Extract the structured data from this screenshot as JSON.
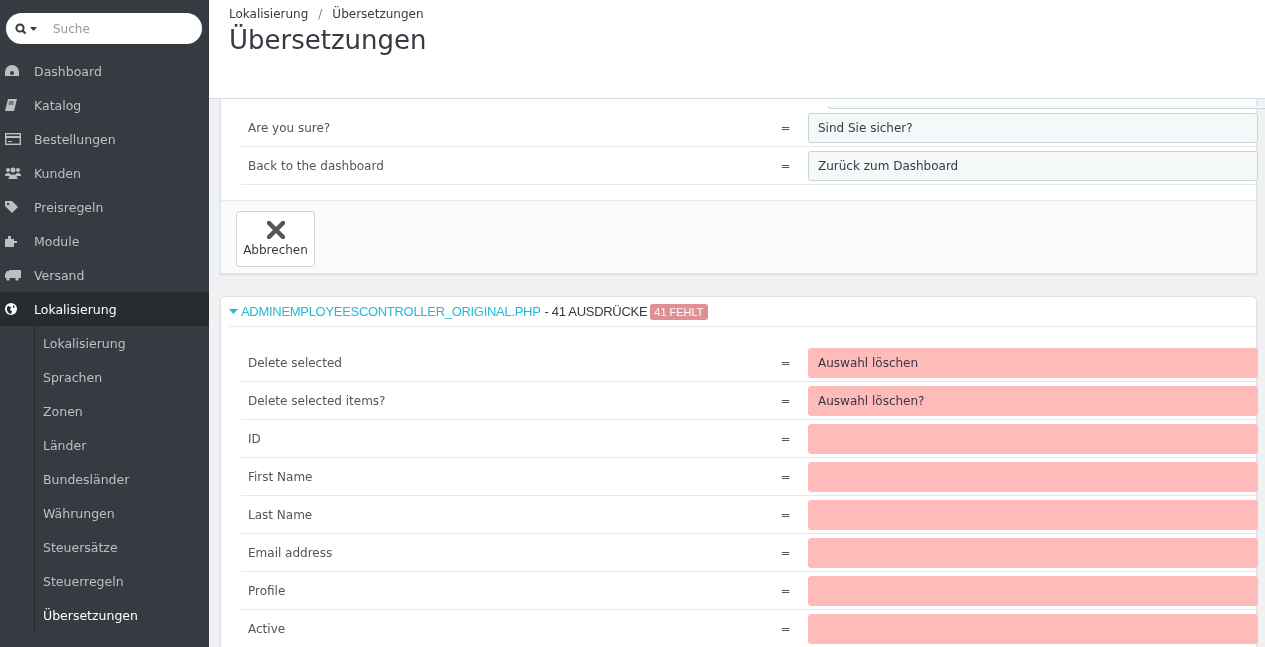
{
  "search": {
    "placeholder": "Suche"
  },
  "sidebar": {
    "items": [
      {
        "label": "Dashboard",
        "kind": "dashboard",
        "selected": false
      },
      {
        "label": "Katalog",
        "kind": "book",
        "selected": false
      },
      {
        "label": "Bestellungen",
        "kind": "card",
        "selected": false
      },
      {
        "label": "Kunden",
        "kind": "users",
        "selected": false
      },
      {
        "label": "Preisregeln",
        "kind": "tags",
        "selected": false
      },
      {
        "label": "Module",
        "kind": "puzzle",
        "selected": false
      },
      {
        "label": "Versand",
        "kind": "truck",
        "selected": false
      },
      {
        "label": "Lokalisierung",
        "kind": "globe",
        "selected": true,
        "children": [
          {
            "label": "Lokalisierung",
            "selected": false
          },
          {
            "label": "Sprachen",
            "selected": false
          },
          {
            "label": "Zonen",
            "selected": false
          },
          {
            "label": "Länder",
            "selected": false
          },
          {
            "label": "Bundesländer",
            "selected": false
          },
          {
            "label": "Währungen",
            "selected": false
          },
          {
            "label": "Steuersätze",
            "selected": false
          },
          {
            "label": "Steuerregeln",
            "selected": false
          },
          {
            "label": "Übersetzungen",
            "selected": true
          }
        ]
      }
    ]
  },
  "breadcrumb": {
    "items": [
      "Lokalisierung",
      "Übersetzungen"
    ],
    "separator": "/"
  },
  "page_title": "Übersetzungen",
  "sections": [
    {
      "rows": [
        {
          "source": "Are you sure?",
          "equals": "=",
          "translation": "Sind Sie sicher?",
          "missing": false
        },
        {
          "source": "Back to the dashboard",
          "equals": "=",
          "translation": "Zurück zum Dashboard",
          "missing": false
        }
      ],
      "actions": [
        {
          "label": "Abbrechen"
        }
      ]
    },
    {
      "title": "ADMINEMPLOYEESCONTROLLER_ORIGINAL.PHP",
      "count": "- 41 AUSDRÜCKE",
      "badge": "41 FEHLT",
      "expanded": true,
      "rows": [
        {
          "source": "Delete selected",
          "equals": "=",
          "translation": "Auswahl löschen",
          "missing": true
        },
        {
          "source": "Delete selected items?",
          "equals": "=",
          "translation": "Auswahl löschen?",
          "missing": true
        },
        {
          "source": "ID",
          "equals": "=",
          "translation": "",
          "missing": true
        },
        {
          "source": "First Name",
          "equals": "=",
          "translation": "",
          "missing": true
        },
        {
          "source": "Last Name",
          "equals": "=",
          "translation": "",
          "missing": true
        },
        {
          "source": "Email address",
          "equals": "=",
          "translation": "",
          "missing": true
        },
        {
          "source": "Profile",
          "equals": "=",
          "translation": "",
          "missing": true
        },
        {
          "source": "Active",
          "equals": "=",
          "translation": "",
          "missing": true
        }
      ]
    }
  ]
}
